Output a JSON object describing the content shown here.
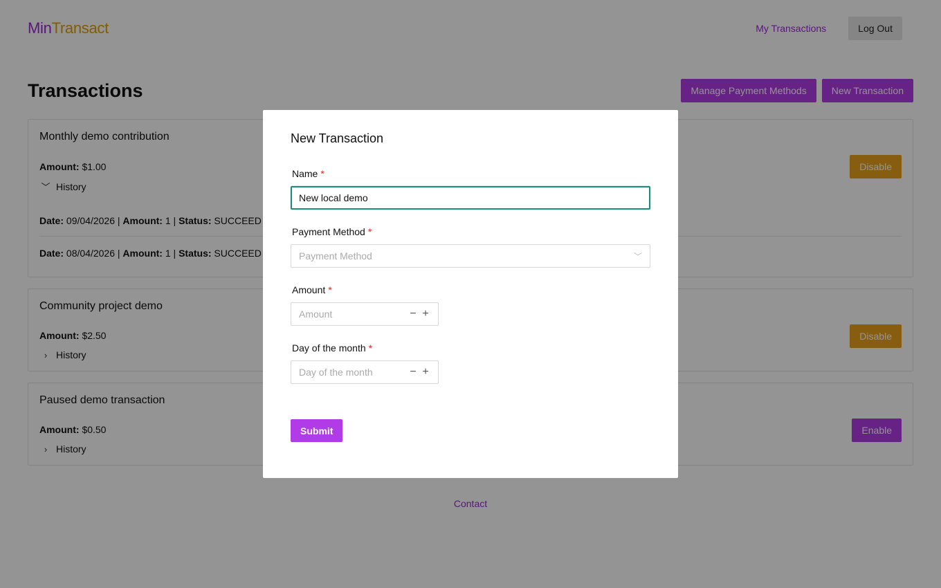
{
  "header": {
    "logo_part1": "Min",
    "logo_part2": "Transact",
    "my_transactions": "My Transactions",
    "logout": "Log Out"
  },
  "main": {
    "title": "Transactions",
    "manage_payment_methods": "Manage Payment Methods",
    "new_transaction": "New Transaction"
  },
  "cards": [
    {
      "name": "Monthly demo contribution",
      "amount_label": "Amount:",
      "amount_value": "$1.00",
      "history_label": "History",
      "history_expanded": true,
      "button": "Disable",
      "history": [
        {
          "date_label": "Date:",
          "date": "09/04/2026",
          "sep1": "|",
          "amount_label": "Amount:",
          "amount": "1",
          "sep2": "|",
          "status_label": "Status:",
          "status": "SUCCEED"
        },
        {
          "date_label": "Date:",
          "date": "08/04/2026",
          "sep1": "|",
          "amount_label": "Amount:",
          "amount": "1",
          "sep2": "|",
          "status_label": "Status:",
          "status": "SUCCEED"
        }
      ]
    },
    {
      "name": "Community project demo",
      "amount_label": "Amount:",
      "amount_value": "$2.50",
      "history_label": "History",
      "history_expanded": false,
      "button": "Disable"
    },
    {
      "name": "Paused demo transaction",
      "amount_label": "Amount:",
      "amount_value": "$0.50",
      "history_label": "History",
      "history_expanded": false,
      "button": "Enable"
    }
  ],
  "footer": {
    "contact": "Contact"
  },
  "modal": {
    "title": "New Transaction",
    "name_label": "Name",
    "name_value": "New local demo",
    "payment_method_label": "Payment Method",
    "payment_method_placeholder": "Payment Method",
    "amount_label": "Amount",
    "amount_placeholder": "Amount",
    "day_label": "Day of the month",
    "day_placeholder": "Day of the month",
    "required_mark": "*",
    "submit": "Submit"
  },
  "colors": {
    "brand_purple": "#b13be6",
    "brand_gold": "#e0a100",
    "disable_orange": "#e8a11a",
    "focus_teal": "#1e8c7a"
  },
  "icons": {
    "expanded": "chevron-down-icon",
    "collapsed": "chevron-right-icon",
    "select_caret": "chevron-down-icon",
    "minus": "minus-icon",
    "plus": "plus-icon"
  }
}
